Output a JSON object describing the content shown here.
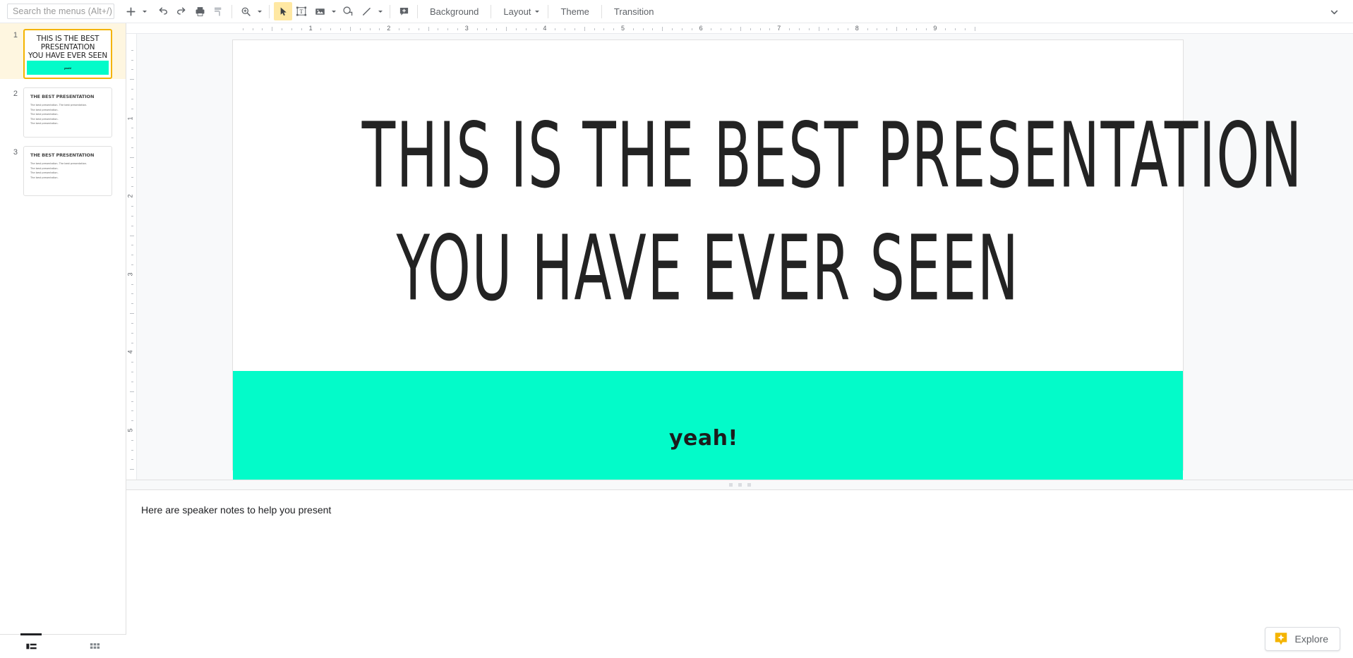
{
  "app": {
    "name": "Google Slides"
  },
  "toolbar": {
    "search": {
      "placeholder": "Search the menus (Alt+/)",
      "icon": "search-icon"
    },
    "buttons": [
      {
        "name": "new-slide-button",
        "icon": "plus-icon",
        "label": "+"
      },
      {
        "name": "new-slide-dropdown",
        "icon": "chevron-down-icon"
      },
      {
        "name": "undo-button",
        "icon": "undo-icon"
      },
      {
        "name": "redo-button",
        "icon": "redo-icon"
      },
      {
        "name": "print-button",
        "icon": "print-icon"
      },
      {
        "name": "paint-format-button",
        "icon": "paint-format-icon"
      },
      {
        "name": "zoom-button",
        "icon": "zoom-in-icon"
      },
      {
        "name": "zoom-dropdown",
        "icon": "chevron-down-icon"
      },
      {
        "name": "select-tool-button",
        "icon": "cursor-arrow-icon",
        "active": true
      },
      {
        "name": "text-box-button",
        "icon": "text-box-icon"
      },
      {
        "name": "insert-image-button",
        "icon": "image-icon"
      },
      {
        "name": "insert-image-dropdown",
        "icon": "chevron-down-icon"
      },
      {
        "name": "shape-button",
        "icon": "shape-icon"
      },
      {
        "name": "line-button",
        "icon": "line-icon"
      },
      {
        "name": "line-dropdown",
        "icon": "chevron-down-icon"
      },
      {
        "name": "comment-button",
        "icon": "add-comment-icon"
      }
    ],
    "menus": [
      {
        "label": "Background",
        "has_caret": false
      },
      {
        "label": "Layout",
        "has_caret": true
      },
      {
        "label": "Theme",
        "has_caret": false
      },
      {
        "label": "Transition",
        "has_caret": false
      }
    ],
    "collapse_icon": "chevron-down-icon"
  },
  "filmstrip": {
    "slides": [
      {
        "number": "1",
        "selected": true,
        "title_lines": [
          "THIS IS THE BEST PRESENTATION",
          "YOU HAVE EVER SEEN"
        ],
        "band_text": "yeah!",
        "band_color": "#03FBC9"
      },
      {
        "number": "2",
        "selected": false,
        "title": "THE BEST PRESENTATION",
        "body": [
          "The best presentation. The best presentation.",
          "The best presentation.",
          "The best presentation.",
          "The best presentation.",
          "The best presentation."
        ]
      },
      {
        "number": "3",
        "selected": false,
        "title": "THE BEST PRESENTATION",
        "body": [
          "The best presentation. The best presentation.",
          "The best presentation.",
          "The best presentation.",
          "The best presentation."
        ]
      }
    ],
    "view_buttons": [
      {
        "name": "filmstrip-view-button",
        "icon": "filmstrip-view-icon",
        "active": true
      },
      {
        "name": "grid-view-button",
        "icon": "grid-view-icon",
        "active": false
      }
    ]
  },
  "rulers": {
    "horizontal_numbers": [
      "1",
      "2",
      "3",
      "4",
      "5",
      "6",
      "7",
      "8",
      "9"
    ],
    "vertical_numbers": [
      "1",
      "2",
      "3",
      "4",
      "5"
    ]
  },
  "slide": {
    "title_line1": "THIS IS THE BEST PRESENTATION",
    "title_line2": "YOU HAVE EVER SEEN",
    "band_text": "yeah!",
    "band_color": "#03FBC9",
    "background_color": "#FFFFFF",
    "title_color": "#232323"
  },
  "notes": {
    "text": "Here are speaker notes to help you present"
  },
  "explore": {
    "label": "Explore",
    "icon": "explore-sparkle-icon",
    "icon_color": "#F4B400"
  }
}
